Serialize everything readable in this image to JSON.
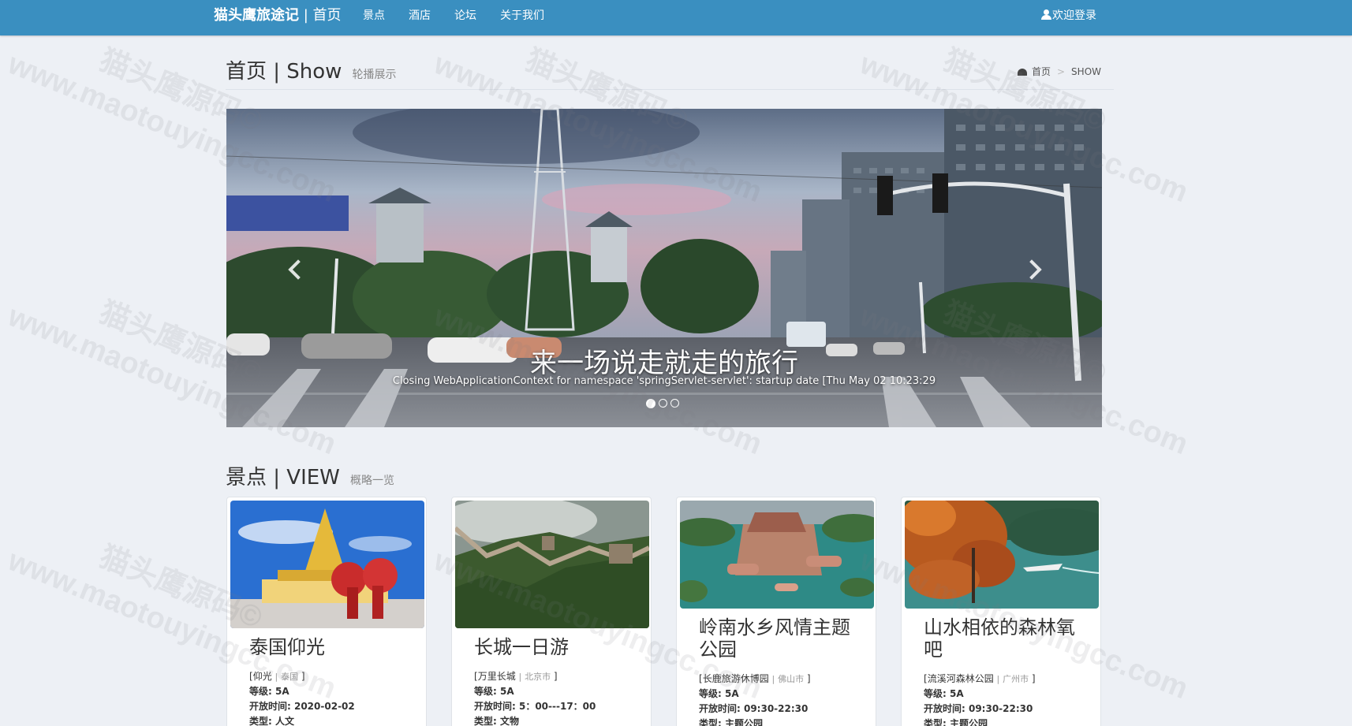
{
  "navbar": {
    "brand": "猫头鹰旅途记",
    "brand_sep": " | ",
    "brand_home": "首页",
    "links": [
      "景点",
      "酒店",
      "论坛",
      "关于我们"
    ],
    "login": "欢迎登录"
  },
  "header": {
    "title": "首页 | Show",
    "subtitle": "轮播展示",
    "breadcrumb": {
      "home": "首页",
      "current": "SHOW"
    }
  },
  "carousel": {
    "caption_title": "来一场说走就走的旅行",
    "caption_text": "Closing WebApplicationContext for namespace 'springServlet-servlet': startup date [Thu May 02 10:23:29",
    "slide_count": 3,
    "active_index": 0
  },
  "views": {
    "title": "景点 | VIEW",
    "subtitle": "概略一览",
    "cards": [
      {
        "title": "泰国仰光",
        "place": "仰光",
        "region": "泰国",
        "level_label": "等级: ",
        "level": "5A",
        "time_label": "开放时间: ",
        "time": "2020-02-02",
        "type_label": "类型: ",
        "type": "人文"
      },
      {
        "title": "长城一日游",
        "place": "万里长城",
        "region": "北京市",
        "level_label": "等级: ",
        "level": "5A",
        "time_label": "开放时间: ",
        "time": "5：00---17：00",
        "type_label": "类型: ",
        "type": "文物"
      },
      {
        "title": "岭南水乡风情主题公园",
        "place": "长鹿旅游休博园",
        "region": "佛山市",
        "level_label": "等级: ",
        "level": "5A",
        "time_label": "开放时间: ",
        "time": "09:30-22:30",
        "type_label": "类型: ",
        "type": "主题公园"
      },
      {
        "title": "山水相依的森林氧吧",
        "place": "流溪河森林公园",
        "region": "广州市",
        "level_label": "等级: ",
        "level": "5A",
        "time_label": "开放时间: ",
        "time": "09:30-22:30",
        "type_label": "类型: ",
        "type": "主题公园"
      }
    ]
  },
  "watermark": {
    "site": "www.maotouyingcc.com",
    "name": "猫头鹰源码©"
  },
  "colors": {
    "navbar": "#3a8fc0",
    "page_bg": "#edf0f5"
  }
}
